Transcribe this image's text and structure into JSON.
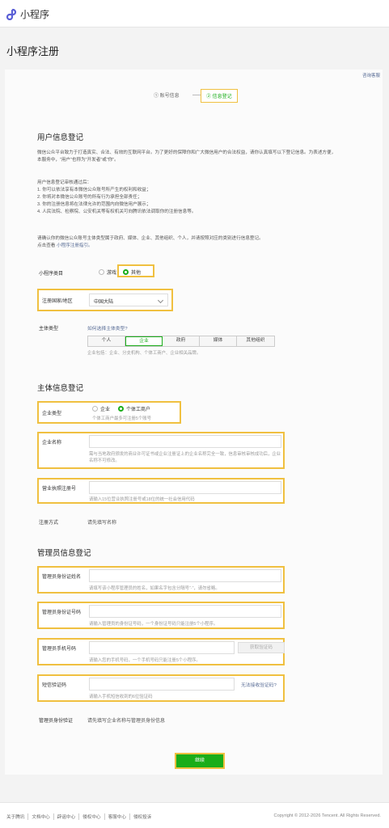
{
  "header": {
    "app_name": "小程序",
    "logo_icon": "miniprogram-logo-icon"
  },
  "page_title": "小程序注册",
  "help_link": "咨询客服",
  "steps": [
    {
      "label": "① 账号信息",
      "active": false
    },
    {
      "label": "② 信息登记",
      "active": true
    }
  ],
  "user_section": {
    "title": "用户信息登记",
    "intro": "微信公众平台致力于打造真实、合法、有效的互联网平台。为了更好的保障你和广大微信用户的合法权益，请你认真填写以下登记信息。",
    "intro2": "为表述方便，本服务中，“用户”也称为“开发者”或“你”。",
    "rules_title": "用户信息登记审核通过后：",
    "rules": [
      "1. 你可以依法享有本微信公众账号所产生的权利和收益；",
      "2. 你将对本微信公众账号的所有行为承担全部责任；",
      "3. 你的注册信息将在法律允许的范围内向微信用户展示；",
      "4. 人民法院、检察院、公安机关等有权机关可向腾讯依法调取你的注册信息等。"
    ],
    "confirm_text": "请确认你的微信公众账号主体类型属于政府、媒体、企业、其他组织、个人，并请按照对应的类别进行信息登记。",
    "view_prefix": "点击查看",
    "view_link": "小程序注册指引。"
  },
  "form": {
    "category_label": "小程序类目",
    "category_options": [
      "游戏",
      "其他"
    ],
    "category_selected": "其他",
    "region_label": "注册国家/地区",
    "region_value": "中国大陆",
    "subject_type_label": "主体类型",
    "subject_type_link": "如何选择主体类型?",
    "subject_types": [
      "个人",
      "企业",
      "政府",
      "媒体",
      "其他组织"
    ],
    "subject_type_selected": "企业",
    "subject_type_hint": "企业包括：企业、分支机构、个体工商户、企业相关品牌。"
  },
  "subject_section": {
    "title": "主体信息登记",
    "company_type_label": "企业类型",
    "company_type_options": [
      "企业",
      "个体工商户"
    ],
    "company_type_selected": "个体工商户",
    "company_type_hint": "个体工商户最多可注册5个账号",
    "company_name_label": "企业名称",
    "company_name_hint": "需与当地政府颁发的商业许可证书或企业注册证上的企业名称完全一致，信息审核审核成功后，企业名称不可修改。",
    "license_label": "营业执照注册号",
    "license_hint": "请输入15位营业执照注册号或18位的统一社会信用代码",
    "reg_method_label": "注册方式",
    "reg_method_value": "请先填写名称"
  },
  "admin_section": {
    "title": "管理员信息登记",
    "name_label": "管理员身份证姓名",
    "name_hint": "请填写该小程序管理员的姓名，如果名字包含分隔号“·”，请勿省略。",
    "id_label": "管理员身份证号码",
    "id_hint": "请输入管理员的身份证号码，一个身份证号码只能注册5个小程序。",
    "phone_label": "管理员手机号码",
    "phone_hint": "请输入您的手机号码，一个手机号码只能注册5个小程序。",
    "sms_button": "获取验证码",
    "sms_label": "短信验证码",
    "sms_link": "无法接收验证码?",
    "sms_hint": "请输入手机短信收到的6位验证码",
    "verify_label": "管理员身份验证",
    "verify_value": "请先填写企业名称与管理员身份信息"
  },
  "continue_button": "继续",
  "footer": {
    "links": [
      "关于腾讯",
      "文档中心",
      "辟谣中心",
      "侵权中心",
      "客服中心",
      "侵权投诉"
    ],
    "copyright": "Copyright © 2012-2026 Tencent. All Rights Reserved."
  },
  "colors": {
    "brand_green": "#1aad19",
    "highlight": "#f0c040",
    "link": "#576b95"
  }
}
